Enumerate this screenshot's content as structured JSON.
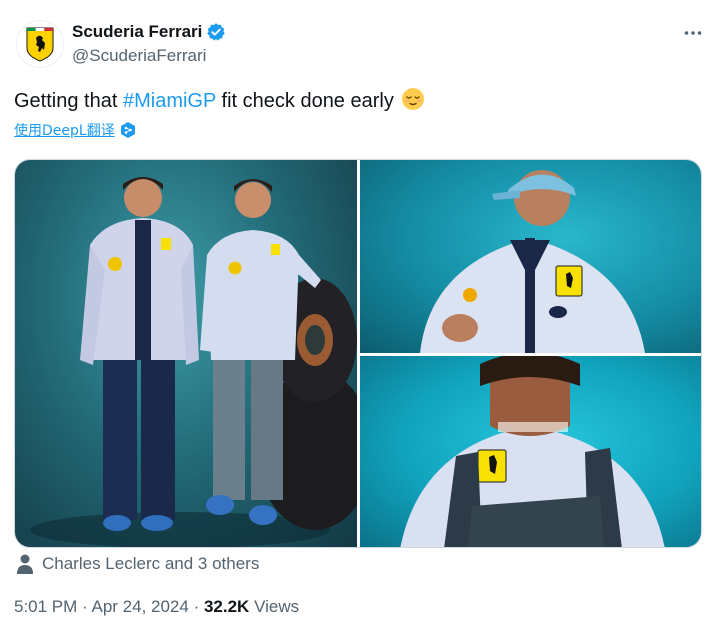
{
  "author": {
    "display_name": "Scuderia Ferrari",
    "handle": "@ScuderiaFerrari",
    "verified": true
  },
  "tweet": {
    "text_before": "Getting that ",
    "hashtag": "#MiamiGP",
    "text_after": " fit check done early",
    "emoji": "relieved-face"
  },
  "translate": {
    "label": "使用DeepL翻译"
  },
  "media": {
    "photos": [
      "photo-1",
      "photo-2",
      "photo-3"
    ]
  },
  "tagged": {
    "text": "Charles Leclerc and 3 others"
  },
  "footer": {
    "time": "5:01 PM",
    "separator": " · ",
    "date": "Apr 24, 2024",
    "views_count": "32.2K",
    "views_label": "Views"
  },
  "colors": {
    "accent": "#1d9bf0",
    "text": "#0f1419",
    "muted": "#536471",
    "ferrari_yellow": "#ffd100"
  }
}
